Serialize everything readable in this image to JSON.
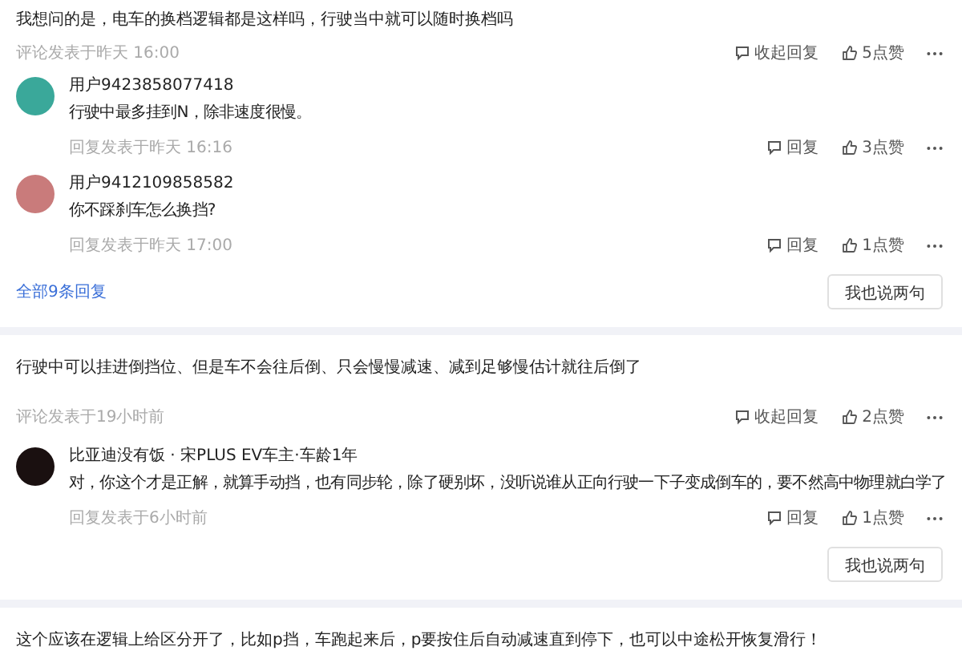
{
  "comments": [
    {
      "text": "我想问的是，电车的换档逻辑都是这样吗，行驶当中就可以随时换档吗",
      "time": "评论发表于昨天 16:00",
      "reply_toggle": "收起回复",
      "likes": "5点赞",
      "replies": [
        {
          "user": "用户9423858077418",
          "color": "#3aa89a",
          "text": "行驶中最多挂到N，除非速度很慢。",
          "time": "回复发表于昨天 16:16",
          "reply": "回复",
          "likes": "3点赞"
        },
        {
          "user": "用户9412109858582",
          "color": "#c97b7b",
          "text": "你不踩刹车怎么换挡?",
          "time": "回复发表于昨天 17:00",
          "reply": "回复",
          "likes": "1点赞"
        }
      ],
      "all_replies": "全部9条回复",
      "write_button": "我也说两句"
    },
    {
      "text": "行驶中可以挂进倒挡位、但是车不会往后倒、只会慢慢减速、减到足够慢估计就往后倒了",
      "time": "评论发表于19小时前",
      "reply_toggle": "收起回复",
      "likes": "2点赞",
      "replies": [
        {
          "user": "比亚迪没有饭 · 宋PLUS EV车主·车龄1年",
          "color": "#1a1010",
          "text": "对，你这个才是正解，就算手动挡，也有同步轮，除了硬别坏，没听说谁从正向行驶一下子变成倒车的，要不然高中物理就白学了",
          "time": "回复发表于6小时前",
          "reply": "回复",
          "likes": "1点赞"
        }
      ],
      "write_button": "我也说两句"
    },
    {
      "text": "这个应该在逻辑上给区分开了，比如p挡，车跑起来后，p要按住后自动减速直到停下，也可以中途松开恢复滑行！"
    }
  ]
}
